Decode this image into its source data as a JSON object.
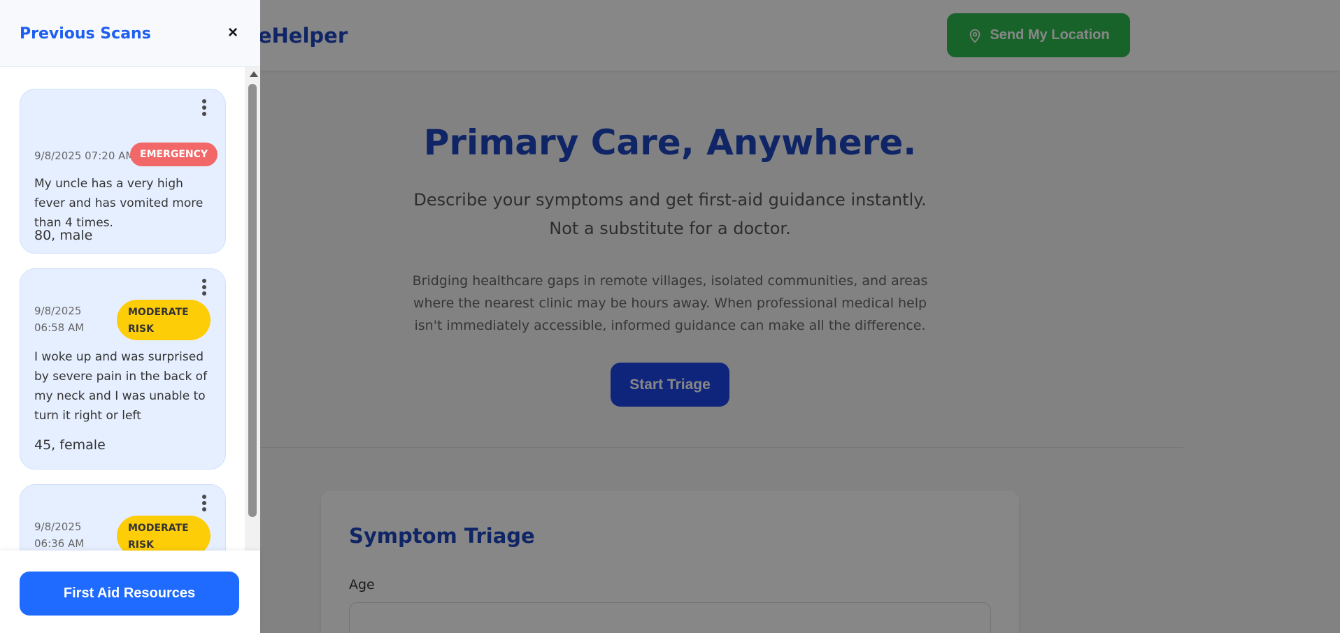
{
  "app": {
    "brand": "MeHelper",
    "send_location_label": "Send My Location"
  },
  "hero": {
    "title": "Primary Care, Anywhere.",
    "subtitle": "Describe your symptoms and get first-aid guidance instantly. Not a substitute for a doctor.",
    "description": "Bridging healthcare gaps in remote villages, isolated communities, and areas where the nearest clinic may be hours away. When professional medical help isn't immediately accessible, informed guidance can make all the difference.",
    "start_label": "Start Triage"
  },
  "triage": {
    "title": "Symptom Triage",
    "age_label": "Age"
  },
  "drawer": {
    "title": "Previous Scans",
    "close_label": "×",
    "first_aid_label": "First Aid Resources",
    "scans": [
      {
        "date": "9/8/2025 07:20 AM",
        "risk": "EMERGENCY",
        "text": "My uncle has a very high fever and has vomited more than 4 times.",
        "meta": "80, male"
      },
      {
        "date": "9/8/2025 06:58 AM",
        "risk": "MODERATE RISK",
        "text": "I woke up and was surprised by severe pain in the back of my neck and I was unable to turn it right or left",
        "meta": "45, female"
      },
      {
        "date": "9/8/2025 06:36 AM",
        "risk": "MODERATE RISK",
        "text": "",
        "meta": ""
      }
    ]
  },
  "colors": {
    "accent": "#1e46c0",
    "emergency": "#f26767",
    "moderate": "#fdcd08",
    "location_button": "#2fbb4f"
  }
}
